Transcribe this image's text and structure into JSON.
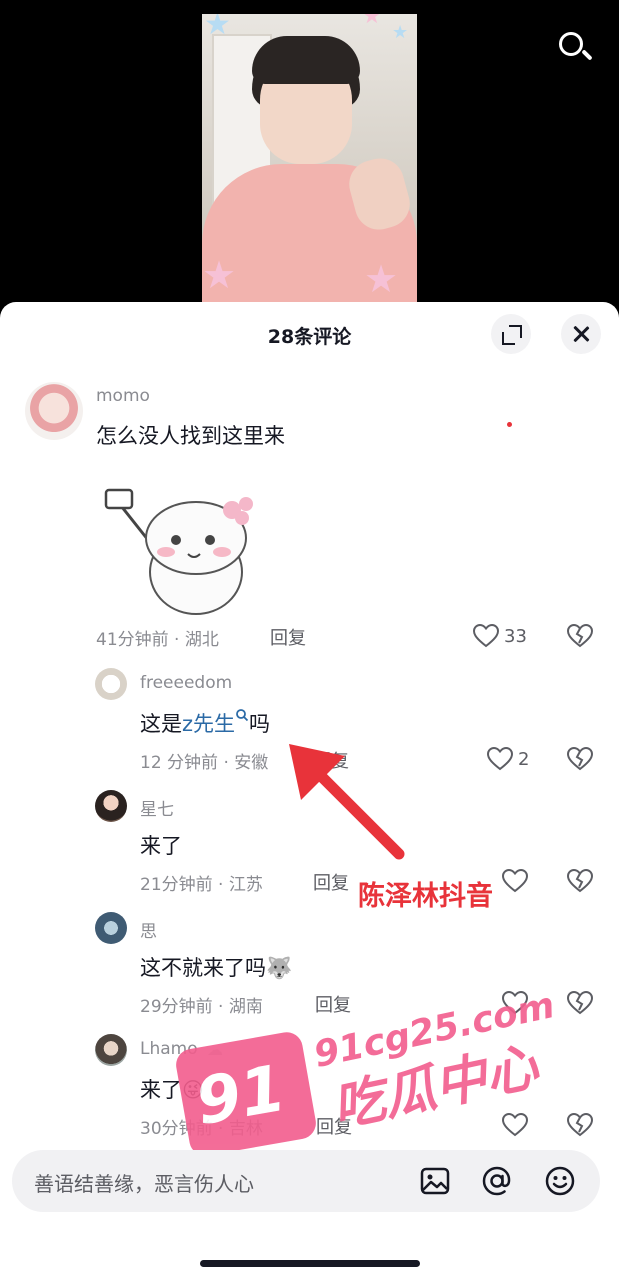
{
  "panel": {
    "title": "28条评论"
  },
  "comments": [
    {
      "username": "momo",
      "text": "怎么没人找到这里来",
      "time_location": "41分钟前 · 湖北",
      "reply_label": "回复",
      "likes": "33",
      "has_sticker": true
    },
    {
      "username": "freeeedom",
      "text_prefix": "这是",
      "mention": "z先生",
      "text_suffix": "吗",
      "time_location": "12 分钟前 · 安徽",
      "reply_label": "回复",
      "likes": "2"
    },
    {
      "username": "星七",
      "text": "来了",
      "time_location": "21分钟前 · 江苏",
      "reply_label": "回复"
    },
    {
      "username": "思",
      "text": "这不就来了吗",
      "text_emoji": "🐺",
      "time_location": "29分钟前 · 湖南",
      "reply_label": "回复"
    },
    {
      "username": "Lhamo",
      "text": "来了",
      "text_emoji": "😜",
      "time_location": "30分钟前 · 吉林",
      "reply_label": "回复"
    }
  ],
  "overlay": {
    "annotation": "陈泽林抖音",
    "watermark_url": "91cg25.com",
    "watermark_cn": "吃瓜中心",
    "watermark_badge": "91"
  },
  "input": {
    "placeholder": "善语结善缘，恶言伤人心"
  },
  "icons": {
    "search": "search-icon",
    "expand": "expand-icon",
    "close": "close-icon",
    "like": "heart-icon",
    "dislike": "broken-heart-icon",
    "image": "image-icon",
    "mention": "at-icon",
    "emoji": "emoji-icon"
  },
  "colors": {
    "mention_link": "#2b6aa6",
    "annotation_red": "#e8333a",
    "watermark_pink": "#f25d8d"
  }
}
